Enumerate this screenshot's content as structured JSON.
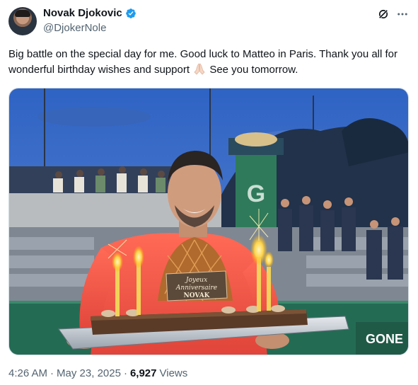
{
  "author": {
    "display_name": "Novak Djokovic",
    "handle": "@DjokerNole",
    "verified": true
  },
  "post": {
    "text_part1": "Big battle on the special day for me. Good luck to Matteo in Paris. Thank you all for wonderful birthday wishes and support",
    "emoji": "folded-hands",
    "text_part2": "See you tomorrow.",
    "time": "4:26 AM",
    "separator": "·",
    "date": "May 23, 2025",
    "views_count": "6,927",
    "views_label": "Views"
  },
  "media": {
    "cake_text_line1": "Joyeux",
    "cake_text_line2": "Anniversaire",
    "cake_text_line3": "NOVAK",
    "sign_text": "GONE"
  },
  "icons": {
    "verified": "verified-badge-icon",
    "grok": "grok-icon",
    "more": "more-icon"
  },
  "colors": {
    "accent": "#1d9bf0",
    "text": "#0f1419",
    "muted": "#536471"
  }
}
